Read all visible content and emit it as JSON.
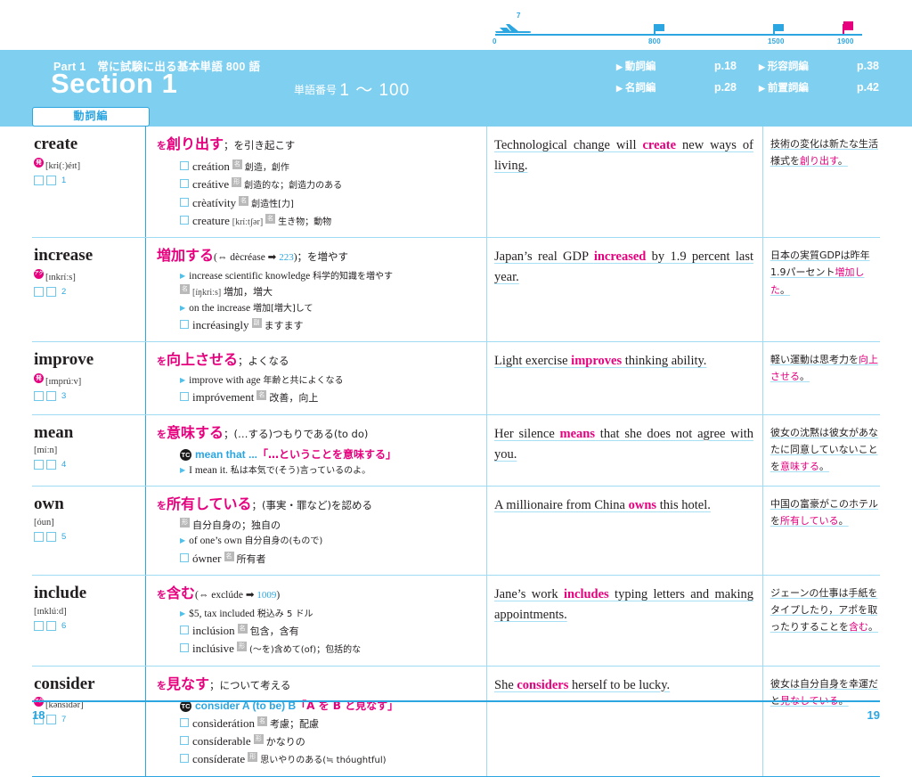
{
  "progress": {
    "ticks": [
      "0",
      "800",
      "1500",
      "1900"
    ],
    "plane_label": "7",
    "accent_blue": "#2ca6e0",
    "accent_pink": "#e6007e"
  },
  "header": {
    "part_line": "Part 1　常に試験に出る基本単語 800 語",
    "section_title": "Section 1",
    "range_label": "単語番号",
    "range_value": "1 〜 100",
    "links": [
      {
        "label": "動詞編",
        "page": "p.18"
      },
      {
        "label": "形容詞編",
        "page": "p.38"
      },
      {
        "label": "名詞編",
        "page": "p.28"
      },
      {
        "label": "前置詞編",
        "page": "p.42"
      }
    ],
    "category_tab": "動詞編"
  },
  "entries": [
    {
      "headword": "create",
      "badge": "発",
      "phonetic": "[kri(ː)éɪt]",
      "number": "1",
      "def_wo": "を",
      "def_main": "創り出す",
      "def_rest": "；を引き起こす",
      "sublines": [
        {
          "marker": "box",
          "term": "creátion",
          "pos": "名",
          "gloss": "創造，創作"
        },
        {
          "marker": "box",
          "term": "creátive",
          "pos": "形",
          "gloss": "創造的な；創造力のある"
        },
        {
          "marker": "box",
          "term": "crèatívity",
          "pos": "名",
          "gloss": "創造性[力]"
        },
        {
          "marker": "box",
          "term": "creature",
          "phon": "[kríːtʃər]",
          "pos": "名",
          "gloss": "生き物；動物"
        }
      ],
      "sentence_pre": "Technological change will ",
      "sentence_key": "create",
      "sentence_post": " new ways of living.",
      "jp_pre": "技術の変化は新たな生活様式を",
      "jp_key": "創り出す",
      "jp_post": "。"
    },
    {
      "headword": "increase",
      "badge": "アク",
      "phonetic": "[ɪnkríːs]",
      "number": "2",
      "def_wo": "",
      "def_main": "増加する",
      "def_paren": "(⇔ dècréase ➡ 223)",
      "def_ref": "223",
      "def_rest": "；を増やす",
      "sublines": [
        {
          "marker": "tri",
          "term": "increase scientific knowledge",
          "gloss": "科学的知識を増やす"
        },
        {
          "marker": "pos",
          "pos": "名",
          "phon": "[íŋkriːs]",
          "gloss": "増加，増大"
        },
        {
          "marker": "tri",
          "term": "on the increase",
          "gloss": "増加[増大]して"
        },
        {
          "marker": "box",
          "term": "incréasingly",
          "pos": "副",
          "gloss": "ますます"
        }
      ],
      "sentence_pre": "Japan’s real GDP ",
      "sentence_key": "increased",
      "sentence_post": " by 1.9 percent last year.",
      "jp_pre": "日本の実質GDPは昨年1.9パーセント",
      "jp_key": "増加した",
      "jp_post": "。"
    },
    {
      "headword": "improve",
      "badge": "発",
      "phonetic": "[ɪmprúːv]",
      "number": "3",
      "def_wo": "を",
      "def_main": "向上させる",
      "def_rest": "；よくなる",
      "sublines": [
        {
          "marker": "tri",
          "term": "improve with age",
          "gloss": "年齢と共によくなる"
        },
        {
          "marker": "box",
          "term": "impróvement",
          "pos": "名",
          "gloss": "改善，向上"
        }
      ],
      "sentence_pre": "Light exercise ",
      "sentence_key": "improves",
      "sentence_post": " thinking ability.",
      "jp_pre": "軽い運動は思考力を",
      "jp_key": "向上させる",
      "jp_post": "。"
    },
    {
      "headword": "mean",
      "badge": "",
      "phonetic": "[míːn]",
      "number": "4",
      "def_wo": "を",
      "def_main": "意味する",
      "def_rest": "；(…する)つもりである(to do)",
      "sublines": [
        {
          "marker": "tc",
          "tc": "TC",
          "term": "mean that ...",
          "quote": "「…ということを意味する」"
        },
        {
          "marker": "tri",
          "term": "I mean it.",
          "gloss": "私は本気で(そう)言っているのよ。"
        }
      ],
      "sentence_pre": "Her silence ",
      "sentence_key": "means",
      "sentence_post": " that she does not agree with you.",
      "jp_pre": "彼女の沈黙は彼女があなたに同意していないことを",
      "jp_key": "意味する",
      "jp_post": "。"
    },
    {
      "headword": "own",
      "badge": "",
      "phonetic": "[óun]",
      "number": "5",
      "def_wo": "を",
      "def_main": "所有している",
      "def_rest": "；(事実・罪など)を認める",
      "sublines": [
        {
          "marker": "pos",
          "pos": "形",
          "gloss": "自分自身の；独自の"
        },
        {
          "marker": "tri",
          "term": "of one’s own",
          "gloss": "自分自身の(もので)"
        },
        {
          "marker": "box",
          "term": "ówner",
          "pos": "名",
          "gloss": "所有者"
        }
      ],
      "sentence_pre": "A millionaire from China ",
      "sentence_key": "owns",
      "sentence_post": " this hotel.",
      "jp_pre": "中国の富豪がこのホテルを",
      "jp_key": "所有している",
      "jp_post": "。"
    },
    {
      "headword": "include",
      "badge": "",
      "phonetic": "[ɪnklúːd]",
      "number": "6",
      "def_wo": "を",
      "def_main": "含む",
      "def_paren": "(⇔ exclúde ➡ 1009)",
      "def_ref": "1009",
      "def_rest": "",
      "sublines": [
        {
          "marker": "tri",
          "term": "$5, tax included",
          "gloss": "税込み 5 ドル"
        },
        {
          "marker": "box",
          "term": "inclúsion",
          "pos": "名",
          "gloss": "包含，含有"
        },
        {
          "marker": "box",
          "term": "inclúsive",
          "pos": "形",
          "gloss": "(〜を)含めて(of)；包括的な"
        }
      ],
      "sentence_pre": "Jane’s work ",
      "sentence_key": "includes",
      "sentence_post": " typing letters and making appointments.",
      "jp_pre": "ジェーンの仕事は手紙をタイプしたり，アポを取ったりすることを",
      "jp_key": "含む",
      "jp_post": "。"
    },
    {
      "headword": "consider",
      "badge": "アク",
      "phonetic": "[kənsídər]",
      "number": "7",
      "def_wo": "を",
      "def_main": "見なす",
      "def_rest": "；について考える",
      "sublines": [
        {
          "marker": "tc",
          "tc": "TC",
          "term": "consider A (to be) B",
          "quote": "「A を B と見なす」"
        },
        {
          "marker": "box",
          "term": "consìderátion",
          "pos": "名",
          "gloss": "考慮；配慮"
        },
        {
          "marker": "box",
          "term": "consíderable",
          "pos": "形",
          "gloss": "かなりの"
        },
        {
          "marker": "box",
          "term": "consíderate",
          "pos": "形",
          "gloss": "思いやりのある(≒ thóughtful)"
        }
      ],
      "sentence_pre": "She ",
      "sentence_key": "considers",
      "sentence_post": " herself to be lucky.",
      "jp_pre": "彼女は自分自身を幸運だと",
      "jp_key": "見なしている",
      "jp_post": "。"
    }
  ],
  "footer": {
    "left_page": "18",
    "right_page": "19"
  }
}
